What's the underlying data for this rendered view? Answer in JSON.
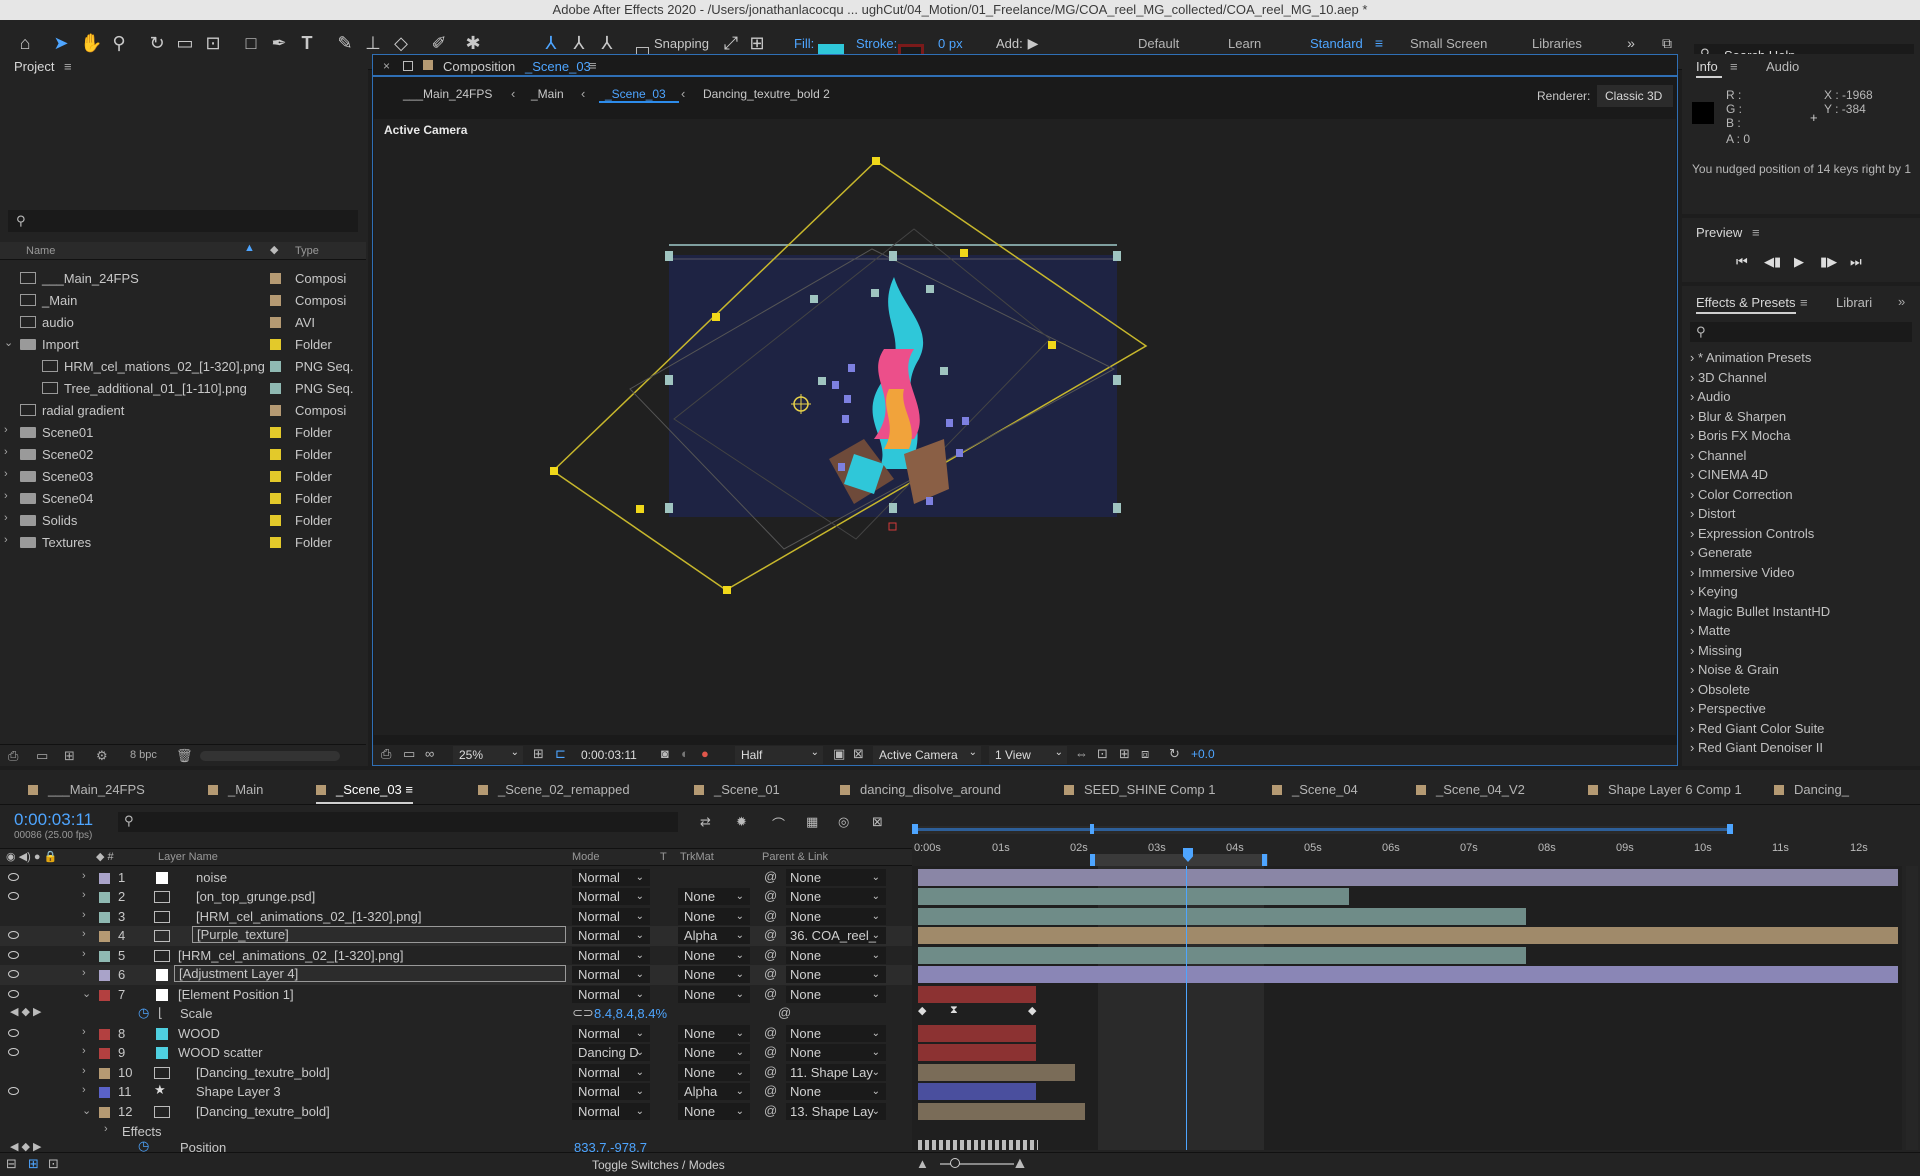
{
  "title": "Adobe After Effects 2020 - /Users/jonathanlacocqu ... ughCut/04_Motion/01_Freelance/MG/COA_reel_MG_collected/COA_reel_MG_10.aep *",
  "toolbar": {
    "snapping": "Snapping",
    "fill": "Fill:",
    "stroke": "Stroke:",
    "stroke_px": "0 px",
    "add": "Add:",
    "workspaces": [
      "Default",
      "Learn",
      "Standard",
      "Small Screen",
      "Libraries"
    ],
    "active_workspace": "Standard",
    "search_placeholder": "Search Help"
  },
  "project": {
    "title": "Project",
    "col_name": "Name",
    "col_type": "Type",
    "bpc": "8 bpc",
    "items": [
      {
        "name": "___Main_24FPS",
        "type": "Composi",
        "kind": "comp",
        "indent": 0,
        "color": "#b59a73"
      },
      {
        "name": "_Main",
        "type": "Composi",
        "kind": "comp",
        "indent": 0,
        "color": "#b59a73"
      },
      {
        "name": "audio",
        "type": "AVI",
        "kind": "file",
        "indent": 0,
        "color": "#b59a73"
      },
      {
        "name": "Import",
        "type": "Folder",
        "kind": "folder-open",
        "indent": 0,
        "color": "#e3c92a"
      },
      {
        "name": "HRM_cel_mations_02_[1-320].png",
        "type": "PNG Seq.",
        "kind": "comp",
        "indent": 1,
        "color": "#8fb9b2"
      },
      {
        "name": "Tree_additional_01_[1-110].png",
        "type": "PNG Seq.",
        "kind": "comp",
        "indent": 1,
        "color": "#8fb9b2"
      },
      {
        "name": "radial gradient",
        "type": "Composi",
        "kind": "comp",
        "indent": 0,
        "color": "#b59a73"
      },
      {
        "name": "Scene01",
        "type": "Folder",
        "kind": "folder",
        "indent": 0,
        "color": "#e3c92a"
      },
      {
        "name": "Scene02",
        "type": "Folder",
        "kind": "folder",
        "indent": 0,
        "color": "#e3c92a"
      },
      {
        "name": "Scene03",
        "type": "Folder",
        "kind": "folder",
        "indent": 0,
        "color": "#e3c92a"
      },
      {
        "name": "Scene04",
        "type": "Folder",
        "kind": "folder",
        "indent": 0,
        "color": "#e3c92a"
      },
      {
        "name": "Solids",
        "type": "Folder",
        "kind": "folder",
        "indent": 0,
        "color": "#e3c92a"
      },
      {
        "name": "Textures",
        "type": "Folder",
        "kind": "folder",
        "indent": 0,
        "color": "#e3c92a"
      }
    ]
  },
  "viewer": {
    "tab_prefix": "Composition",
    "tab_comp": "_Scene_03",
    "breadcrumbs": [
      "___Main_24FPS",
      "_Main",
      "_Scene_03",
      "Dancing_texutre_bold 2"
    ],
    "renderer_label": "Renderer:",
    "renderer": "Classic 3D",
    "camera_label": "Active Camera",
    "zoom": "25%",
    "timecode": "0:00:03:11",
    "resolution": "Half",
    "camera": "Active Camera",
    "views": "1 View",
    "exposure": "+0.0"
  },
  "info": {
    "tab_info": "Info",
    "tab_audio": "Audio",
    "r": "R :",
    "g": "G :",
    "b": "B :",
    "a": "A :  0",
    "x": "X : -1968",
    "y": "Y : -384",
    "message": "You nudged position of 14 keys right by 1"
  },
  "preview": {
    "title": "Preview"
  },
  "effects": {
    "tab": "Effects & Presets",
    "tab2": "Librari",
    "items": [
      "* Animation Presets",
      "3D Channel",
      "Audio",
      "Blur & Sharpen",
      "Boris FX Mocha",
      "Channel",
      "CINEMA 4D",
      "Color Correction",
      "Distort",
      "Expression Controls",
      "Generate",
      "Immersive Video",
      "Keying",
      "Magic Bullet InstantHD",
      "Matte",
      "Missing",
      "Noise & Grain",
      "Obsolete",
      "Perspective",
      "Red Giant Color Suite",
      "Red Giant Denoiser II"
    ]
  },
  "timeline": {
    "tabs": [
      {
        "name": "___Main_24FPS",
        "color": "#b59a73"
      },
      {
        "name": "_Main",
        "color": "#b59a73"
      },
      {
        "name": "_Scene_03",
        "color": "#b59a73",
        "active": true
      },
      {
        "name": "_Scene_02_remapped",
        "color": "#b59a73"
      },
      {
        "name": "_Scene_01",
        "color": "#b59a73"
      },
      {
        "name": "dancing_disolve_around",
        "color": "#b59a73"
      },
      {
        "name": "SEED_SHINE Comp 1",
        "color": "#b59a73"
      },
      {
        "name": "_Scene_04",
        "color": "#b59a73"
      },
      {
        "name": "_Scene_04_V2",
        "color": "#b59a73"
      },
      {
        "name": "Shape Layer 6 Comp 1",
        "color": "#b59a73"
      },
      {
        "name": "Dancing_",
        "color": "#b59a73"
      }
    ],
    "timecode": "0:00:03:11",
    "frames": "00086 (25.00 fps)",
    "col_layer": "Layer Name",
    "col_mode": "Mode",
    "col_t": "T",
    "col_trkmat": "TrkMat",
    "col_parent": "Parent & Link",
    "ruler": [
      "0:00s",
      "01s",
      "02s",
      "03s",
      "04s",
      "05s",
      "06s",
      "07s",
      "08s",
      "09s",
      "10s",
      "11s",
      "12s"
    ],
    "toggle": "Toggle Switches / Modes",
    "layers": [
      {
        "num": "1",
        "name": "noise",
        "mode": "Normal",
        "trk": "",
        "parent": "None",
        "color": "#a9a3c9",
        "bar": "#8a86a6",
        "bar_start": 0,
        "bar_end": 1.0
      },
      {
        "num": "2",
        "name": "[on_top_grunge.psd]",
        "mode": "Normal",
        "trk": "None",
        "parent": "None",
        "color": "#8fb9b2",
        "bar": "#6f8c88",
        "bar_start": 0,
        "bar_end": 0.44
      },
      {
        "num": "3",
        "name": "[HRM_cel_animations_02_[1-320].png]",
        "mode": "Normal",
        "trk": "None",
        "parent": "None",
        "color": "#8fb9b2",
        "bar": "#6f8c88",
        "bar_start": 0,
        "bar_end": 0.62
      },
      {
        "num": "4",
        "name": "[Purple_texture]",
        "mode": "Normal",
        "trk": "Alpha",
        "parent": "36. COA_reel_",
        "color": "#b59a73",
        "bar": "#a08a6a",
        "bar_start": 0,
        "bar_end": 1.0
      },
      {
        "num": "5",
        "name": "[HRM_cel_animations_02_[1-320].png]",
        "mode": "Normal",
        "trk": "None",
        "parent": "None",
        "color": "#8fb9b2",
        "bar": "#6f8c88",
        "bar_start": 0,
        "bar_end": 0.62
      },
      {
        "num": "6",
        "name": "[Adjustment Layer 4]",
        "mode": "Normal",
        "trk": "None",
        "parent": "None",
        "color": "#a9a3c9",
        "bar": "#8a86b6",
        "bar_start": 0,
        "bar_end": 1.0
      },
      {
        "num": "7",
        "name": "[Element Position 1]",
        "mode": "Normal",
        "trk": "None",
        "parent": "None",
        "color": "#b34040",
        "bar": "#8c3232",
        "bar_start": 0,
        "bar_end": 0.12
      },
      {
        "num": "8",
        "name": "WOOD",
        "mode": "Normal",
        "trk": "None",
        "parent": "None",
        "color": "#b34040",
        "bar": "#8c3232",
        "bar_start": 0,
        "bar_end": 0.12
      },
      {
        "num": "9",
        "name": "WOOD scatter",
        "mode": "Dancing D",
        "trk": "None",
        "parent": "None",
        "color": "#b34040",
        "bar": "#8c3232",
        "bar_start": 0,
        "bar_end": 0.12
      },
      {
        "num": "10",
        "name": "[Dancing_texutre_bold]",
        "mode": "Normal",
        "trk": "None",
        "parent": "11. Shape Lay",
        "color": "#b59a73",
        "bar": "#7a6c58",
        "bar_start": 0,
        "bar_end": 0.16
      },
      {
        "num": "11",
        "name": "Shape Layer 3",
        "mode": "Normal",
        "trk": "Alpha",
        "parent": "None",
        "color": "#5a62c8",
        "bar": "#4a4f9e",
        "bar_start": 0,
        "bar_end": 0.12
      },
      {
        "num": "12",
        "name": "[Dancing_texutre_bold]",
        "mode": "Normal",
        "trk": "None",
        "parent": "13. Shape Lay",
        "color": "#b59a73",
        "bar": "#7a6c58",
        "bar_start": 0,
        "bar_end": 0.17
      }
    ],
    "scale_label": "Scale",
    "scale_value": "8.4,8.4,8.4%",
    "effects_label": "Effects",
    "position_label": "Position",
    "position_value": "833.7,-978.7"
  },
  "colors": {
    "accent": "#2d8ceb",
    "fill_swatch": "#2fc7d9",
    "stroke_swatch": "#7a1a1a",
    "selection": "#e3c92a"
  }
}
